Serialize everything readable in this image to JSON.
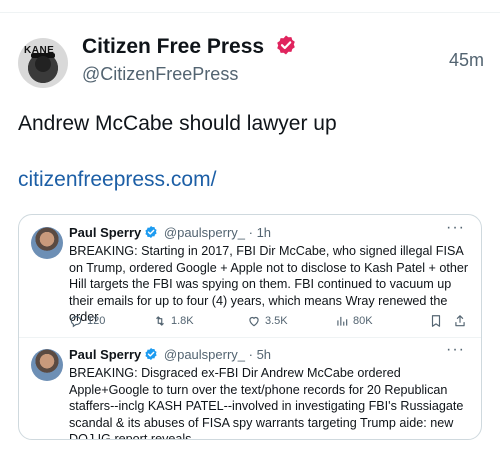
{
  "post": {
    "display_name": "Citizen Free Press",
    "handle": "@CitizenFreePress",
    "timestamp": "45m",
    "avatar_text": "KANE",
    "text": "Andrew McCabe should lawyer up",
    "link": "citizenfreepress.com/"
  },
  "quoted": [
    {
      "name": "Paul Sperry",
      "handle": "@paulsperry_",
      "time": "· 1h",
      "text": "BREAKING: Starting in 2017, FBI Dir McCabe, who signed illegal FISA on Trump, ordered Google + Apple not to disclose to Kash Patel + other Hill targets the FBI was spying on them. FBI continued to vacuum up their emails for up to four (4) years, which means Wray renewed the order",
      "replies": "120",
      "reposts": "1.8K",
      "likes": "3.5K",
      "views": "80K"
    },
    {
      "name": "Paul Sperry",
      "handle": "@paulsperry_",
      "time": "· 5h",
      "text": "BREAKING: Disgraced ex-FBI Dir Andrew McCabe ordered Apple+Google to turn over the text/phone records for 20 Republican staffers--inclg KASH PATEL--involved in investigating FBI's Russiagate scandal & its abuses of FISA spy warrants targeting Trump aide: new DOJ IG report reveals"
    }
  ],
  "icons": {
    "more": "more-icon",
    "verified": "verified-badge-icon",
    "reply": "reply-icon",
    "repost": "repost-icon",
    "like": "like-icon",
    "views": "views-icon",
    "bookmark": "bookmark-icon",
    "share": "share-icon"
  },
  "colors": {
    "verified_badge": "#e0245e",
    "link": "#1d5fa6",
    "secondary_text": "#536471"
  }
}
